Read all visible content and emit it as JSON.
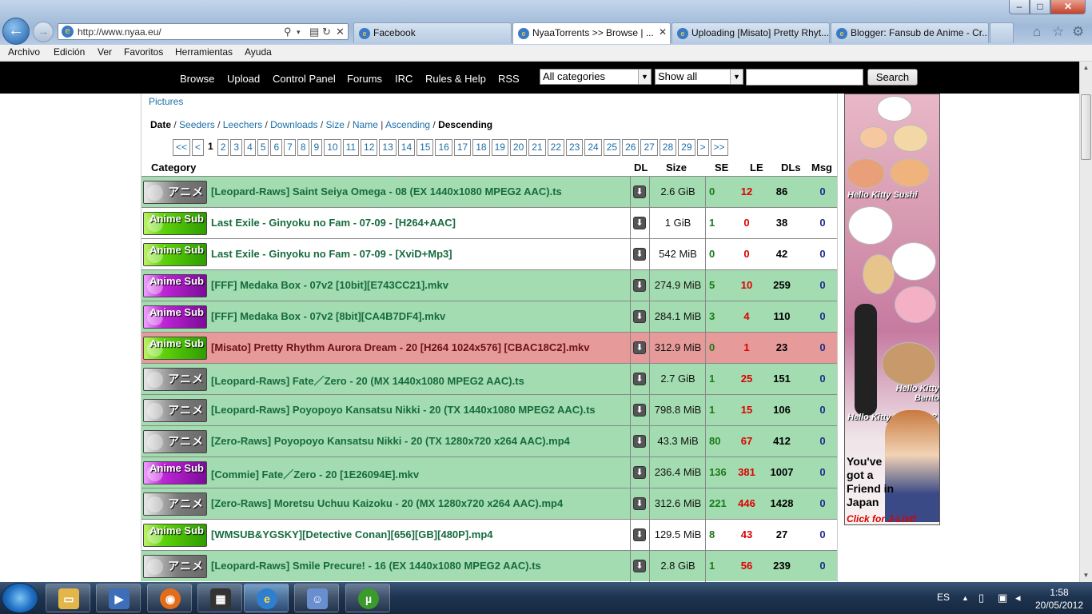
{
  "browser": {
    "url": "http://www.nyaa.eu/",
    "tabs": [
      {
        "label": "Facebook"
      },
      {
        "label": "NyaaTorrents >> Browse | ..."
      },
      {
        "label": "Uploading [Misato] Pretty Rhyt..."
      },
      {
        "label": "Blogger: Fansub de Anime - Cr..."
      }
    ],
    "menu": [
      "Archivo",
      "Edición",
      "Ver",
      "Favoritos",
      "Herramientas",
      "Ayuda"
    ]
  },
  "site_nav": {
    "links": [
      "Browse",
      "Upload",
      "Control Panel",
      "Forums",
      "IRC",
      "Rules & Help",
      "RSS"
    ],
    "category_select": "All categories",
    "filter_select": "Show all",
    "search_value": "",
    "search_button": "Search"
  },
  "listing": {
    "pictures_link": "Pictures",
    "sort": {
      "date": "Date",
      "seeders": "Seeders",
      "leechers": "Leechers",
      "downloads": "Downloads",
      "size": "Size",
      "name": "Name",
      "ascending": "Ascending",
      "descending": "Descending",
      "slash": " / ",
      "pipe": " | "
    },
    "pages": [
      "<<",
      "<",
      "1",
      "2",
      "3",
      "4",
      "5",
      "6",
      "7",
      "8",
      "9",
      "10",
      "11",
      "12",
      "13",
      "14",
      "15",
      "16",
      "17",
      "18",
      "19",
      "20",
      "21",
      "22",
      "23",
      "24",
      "25",
      "26",
      "27",
      "28",
      "29",
      ">",
      ">>"
    ],
    "current_page": "1",
    "columns": {
      "category": "Category",
      "dl": "DL",
      "size": "Size",
      "se": "SE",
      "le": "LE",
      "dls": "DLs",
      "msg": "Msg"
    },
    "rows": [
      {
        "cat": "raw",
        "cat_label": "アニメ",
        "name": "[Leopard-Raws] Saint Seiya Omega - 08 (EX 1440x1080 MPEG2 AAC).ts",
        "size": "2.6 GiB",
        "se": "0",
        "le": "12",
        "dls": "86",
        "msg": "0",
        "status": "normal"
      },
      {
        "cat": "anime-green",
        "cat_label": "Anime Sub",
        "name": "Last Exile - Ginyoku no Fam - 07-09 - [H264+AAC]",
        "size": "1 GiB",
        "se": "1",
        "le": "0",
        "dls": "38",
        "msg": "0",
        "status": "white"
      },
      {
        "cat": "anime-green",
        "cat_label": "Anime Sub",
        "name": "Last Exile - Ginyoku no Fam - 07-09 - [XviD+Mp3]",
        "size": "542 MiB",
        "se": "0",
        "le": "0",
        "dls": "42",
        "msg": "0",
        "status": "white"
      },
      {
        "cat": "anime-purple",
        "cat_label": "Anime Sub",
        "name": "[FFF] Medaka Box - 07v2 [10bit][E743CC21].mkv",
        "size": "274.9 MiB",
        "se": "5",
        "le": "10",
        "dls": "259",
        "msg": "0",
        "status": "normal"
      },
      {
        "cat": "anime-purple",
        "cat_label": "Anime Sub",
        "name": "[FFF] Medaka Box - 07v2 [8bit][CA4B7DF4].mkv",
        "size": "284.1 MiB",
        "se": "3",
        "le": "4",
        "dls": "110",
        "msg": "0",
        "status": "normal"
      },
      {
        "cat": "anime-green",
        "cat_label": "Anime Sub",
        "name": "[Misato] Pretty Rhythm Aurora Dream - 20 [H264 1024x576] [CBAC18C2].mkv",
        "size": "312.9 MiB",
        "se": "0",
        "le": "1",
        "dls": "23",
        "msg": "0",
        "status": "red"
      },
      {
        "cat": "raw",
        "cat_label": "アニメ",
        "name": "[Leopard-Raws] Fate／Zero - 20 (MX 1440x1080 MPEG2 AAC).ts",
        "size": "2.7 GiB",
        "se": "1",
        "le": "25",
        "dls": "151",
        "msg": "0",
        "status": "normal"
      },
      {
        "cat": "raw",
        "cat_label": "アニメ",
        "name": "[Leopard-Raws] Poyopoyo Kansatsu Nikki - 20 (TX 1440x1080 MPEG2 AAC).ts",
        "size": "798.8 MiB",
        "se": "1",
        "le": "15",
        "dls": "106",
        "msg": "0",
        "status": "normal"
      },
      {
        "cat": "raw",
        "cat_label": "アニメ",
        "name": "[Zero-Raws] Poyopoyo Kansatsu Nikki - 20 (TX 1280x720 x264 AAC).mp4",
        "size": "43.3 MiB",
        "se": "80",
        "le": "67",
        "dls": "412",
        "msg": "0",
        "status": "normal"
      },
      {
        "cat": "anime-purple",
        "cat_label": "Anime Sub",
        "name": "[Commie] Fate／Zero - 20 [1E26094E].mkv",
        "size": "236.4 MiB",
        "se": "136",
        "le": "381",
        "dls": "1007",
        "msg": "0",
        "status": "normal"
      },
      {
        "cat": "raw",
        "cat_label": "アニメ",
        "name": "[Zero-Raws] Moretsu Uchuu Kaizoku - 20 (MX 1280x720 x264 AAC).mp4",
        "size": "312.6 MiB",
        "se": "221",
        "le": "446",
        "dls": "1428",
        "msg": "0",
        "status": "normal"
      },
      {
        "cat": "anime-green",
        "cat_label": "Anime Sub",
        "name": "[WMSUB&YGSKY][Detective Conan][656][GB][480P].mp4",
        "size": "129.5 MiB",
        "se": "8",
        "le": "43",
        "dls": "27",
        "msg": "0",
        "status": "white"
      },
      {
        "cat": "raw",
        "cat_label": "アニメ",
        "name": "[Leopard-Raws] Smile Precure! - 16 (EX 1440x1080 MPEG2 AAC).ts",
        "size": "2.8 GiB",
        "se": "1",
        "le": "56",
        "dls": "239",
        "msg": "0",
        "status": "normal"
      }
    ]
  },
  "ad": {
    "sushi": "Hello Kitty Sushi",
    "bento": "Hello Kitty Bento",
    "vibrators": "Hello Kitty Vibrators?",
    "friend": "You've got a Friend in Japan",
    "cta": "Click for J-List!"
  },
  "taskbar": {
    "lang": "ES",
    "time": "1:58",
    "date": "20/05/2012"
  },
  "colors": {
    "row_green": "#a3dcb0",
    "row_red": "#e79a9a",
    "nav_black": "#000000",
    "link_blue": "#1b6fa8"
  }
}
